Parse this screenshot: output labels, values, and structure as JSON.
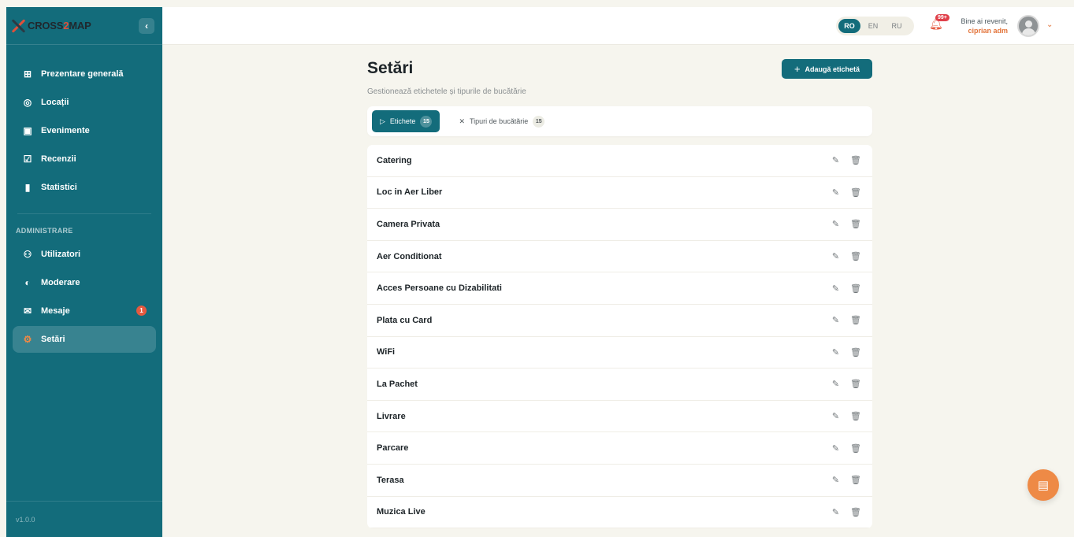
{
  "brand": {
    "logo_part1": "CROSS",
    "logo_part2": "2",
    "logo_part3": "MAP",
    "collapse_icon": "chevron-left-icon"
  },
  "sidebar": {
    "items": [
      {
        "label": "Prezentare generală",
        "icon": "grid-icon",
        "glyph": "⊞"
      },
      {
        "label": "Locații",
        "icon": "location-pin-icon",
        "glyph": "◎"
      },
      {
        "label": "Evenimente",
        "icon": "calendar-icon",
        "glyph": "▣"
      },
      {
        "label": "Recenzii",
        "icon": "review-icon",
        "glyph": "☑"
      },
      {
        "label": "Statistici",
        "icon": "bar-chart-icon",
        "glyph": "▮"
      }
    ],
    "admin_label": "ADMINISTRARE",
    "admin_items": [
      {
        "label": "Utilizatori",
        "icon": "users-icon",
        "glyph": "⚇"
      },
      {
        "label": "Moderare",
        "icon": "shield-icon",
        "glyph": "◐"
      },
      {
        "label": "Mesaje",
        "icon": "mail-icon",
        "glyph": "✉",
        "badge": "1"
      },
      {
        "label": "Setări",
        "icon": "gear-icon",
        "glyph": "⚙",
        "active": true
      }
    ],
    "version": "v1.0.0"
  },
  "topbar": {
    "languages": [
      "RO",
      "EN",
      "RU"
    ],
    "active_language": "RO",
    "notification_count": "99+",
    "welcome": "Bine ai revenit,",
    "username": "ciprian adm"
  },
  "page": {
    "title": "Setări",
    "subtitle": "Gestionează etichetele și tipurile de bucătărie",
    "add_button": "Adaugă etichetă"
  },
  "tabs": [
    {
      "label": "Etichete",
      "count": "15",
      "icon": "tag-icon",
      "active": true
    },
    {
      "label": "Tipuri de bucătărie",
      "count": "15",
      "icon": "utensils-icon",
      "active": false
    }
  ],
  "tags": [
    "Catering",
    "Loc in Aer Liber",
    "Camera Privata",
    "Aer Conditionat",
    "Acces Persoane cu Dizabilitati",
    "Plata cu Card",
    "WiFi",
    "La Pachet",
    "Livrare",
    "Parcare",
    "Terasa",
    "Muzica Live"
  ],
  "colors": {
    "primary": "#136c7b",
    "accent": "#ee8a46",
    "background": "#f6f5ee"
  }
}
